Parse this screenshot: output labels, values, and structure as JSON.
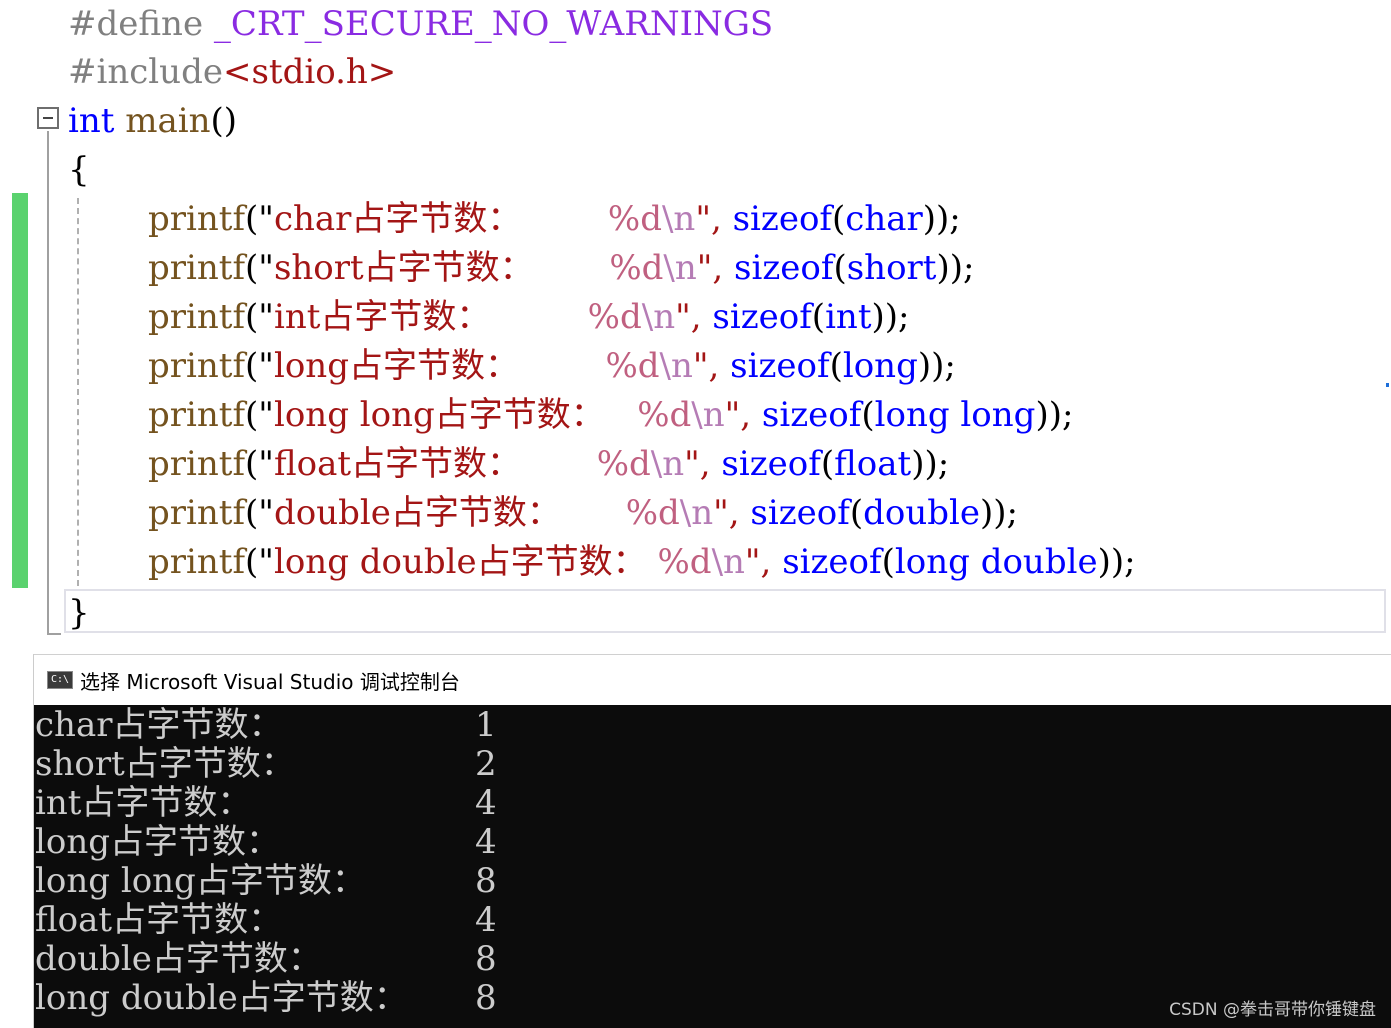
{
  "editor": {
    "lines": [
      {
        "directive": "#define",
        "macro": "_CRT_SECURE_NO_WARNINGS"
      },
      {
        "directive": "#include",
        "header": "<stdio.h>"
      },
      {
        "kw": "int",
        "name": "main",
        "parens": "()"
      },
      {
        "text": "{"
      }
    ],
    "printf_lines": [
      {
        "fn": "printf",
        "open": "(\"",
        "label": "char占字节数：",
        "pad": "        ",
        "fmt": "%d",
        "esc": "\\n",
        "close_str": "\",",
        "sizeof": "sizeof",
        "type": "char",
        "end": "));"
      },
      {
        "fn": "printf",
        "open": "(\"",
        "label": "short占字节数：",
        "pad": "       ",
        "fmt": "%d",
        "esc": "\\n",
        "close_str": "\",",
        "sizeof": "sizeof",
        "type": "short",
        "end": "));"
      },
      {
        "fn": "printf",
        "open": "(\"",
        "label": "int占字节数：",
        "pad": "         ",
        "fmt": "%d",
        "esc": "\\n",
        "close_str": "\",",
        "sizeof": "sizeof",
        "type": "int",
        "end": "));"
      },
      {
        "fn": "printf",
        "open": "(\"",
        "label": "long占字节数：",
        "pad": "        ",
        "fmt": "%d",
        "esc": "\\n",
        "close_str": "\",",
        "sizeof": "sizeof",
        "type": "long",
        "end": "));"
      },
      {
        "fn": "printf",
        "open": "(\"",
        "label": "long long占字节数：",
        "pad": "   ",
        "fmt": "%d",
        "esc": "\\n",
        "close_str": "\",",
        "sizeof": "sizeof",
        "type": "long long",
        "end": "));"
      },
      {
        "fn": "printf",
        "open": "(\"",
        "label": "float占字节数：",
        "pad": "       ",
        "fmt": "%d",
        "esc": "\\n",
        "close_str": "\",",
        "sizeof": "sizeof",
        "type": "float",
        "end": "));"
      },
      {
        "fn": "printf",
        "open": "(\"",
        "label": "double占字节数：",
        "pad": "      ",
        "fmt": "%d",
        "esc": "\\n",
        "close_str": "\",",
        "sizeof": "sizeof",
        "type": "double",
        "end": "));"
      },
      {
        "fn": "printf",
        "open": "(\"",
        "label": "long double占字节数：",
        "pad": " ",
        "fmt": "%d",
        "esc": "\\n",
        "close_str": "\",",
        "sizeof": "sizeof",
        "type": "long double",
        "end": "));"
      }
    ],
    "closing": "}"
  },
  "console": {
    "icon_text": "C:\\",
    "title": "选择 Microsoft Visual Studio 调试控制台",
    "rows": [
      {
        "label": "char占字节数：",
        "value": "1"
      },
      {
        "label": "short占字节数：",
        "value": "2"
      },
      {
        "label": "int占字节数：",
        "value": "4"
      },
      {
        "label": "long占字节数：",
        "value": "4"
      },
      {
        "label": "long long占字节数：",
        "value": "8"
      },
      {
        "label": "float占字节数：",
        "value": "4"
      },
      {
        "label": "double占字节数：",
        "value": "8"
      },
      {
        "label": "long double占字节数：",
        "value": "8"
      }
    ]
  },
  "watermark": "CSDN @拳击哥带你锤键盘",
  "colors": {
    "keyword": "#0000ff",
    "string": "#a31515",
    "function": "#74531f",
    "macro": "#8a2be2",
    "change_bar": "#5ad26e",
    "console_bg": "#0c0c0c",
    "console_text": "#cccccc"
  }
}
